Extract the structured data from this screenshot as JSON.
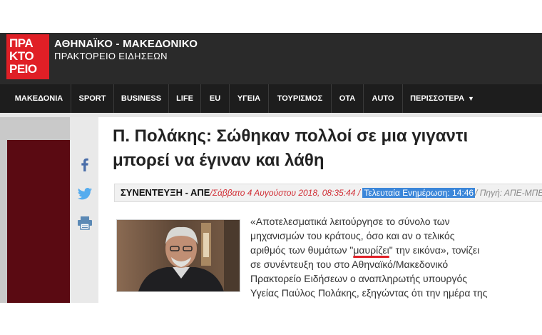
{
  "header": {
    "logo_lines": [
      "ΠΡΑ",
      "ΚΤΟ",
      "ΡΕΙΟ"
    ],
    "brand_name": "ΑΘΗΝΑΪΚΟ - ΜΑΚΕΔΟΝΙΚΟ",
    "brand_sub": "ΠΡΑΚΤΟΡΕΙΟ ΕΙΔΗΣΕΩΝ",
    "logo_color": "#e01f26"
  },
  "nav": {
    "items": [
      "ΜΑΚΕΔΟΝΙΑ",
      "SPORT",
      "BUSINESS",
      "LIFE",
      "EU",
      "ΥΓΕΙΑ",
      "ΤΟΥΡΙΣΜΟΣ",
      "ΟΤΑ",
      "AUTO",
      "ΠΕΡΙΣΣΟΤΕΡΑ"
    ],
    "more_icon": "caret-down-icon"
  },
  "share": {
    "icons": [
      "facebook-icon",
      "twitter-icon",
      "print-icon"
    ]
  },
  "article": {
    "title_line1": "Π. Πολάκης: Σώθηκαν πολλοί σε μια γιγαντι",
    "title_line2": "μπορεί να έγιναν και λάθη",
    "category": "ΣΥΝΕΝΤΕΥΞΗ - ΑΠΕ",
    "date": "/Σάββατο 4 Αυγούστου 2018, 08:35:44 /",
    "updated": "Τελευταία Ενημέρωση: 14:46",
    "source": "/ Πηγή: ΑΠΕ-ΜΠΕ",
    "lines": [
      "«Αποτελεσματικά λειτούργησε το σύνολο των",
      "μηχανισμών του κράτους, όσο και αν ο τελικός",
      [
        "αριθμός των θυμάτων \"",
        "μαυρίζει",
        "\" την εικόνα», τονίζει"
      ],
      "σε συνέντευξη του στο Αθηναϊκό/Μακεδονικό",
      "Πρακτορείο Ειδήσεων ο αναπληρωτής υπουργός",
      "Υγείας Παύλος Πολάκης, εξηγώντας ότι την ημέρα της"
    ],
    "accent": "#d12f36",
    "highlight": "#3b86d9"
  }
}
